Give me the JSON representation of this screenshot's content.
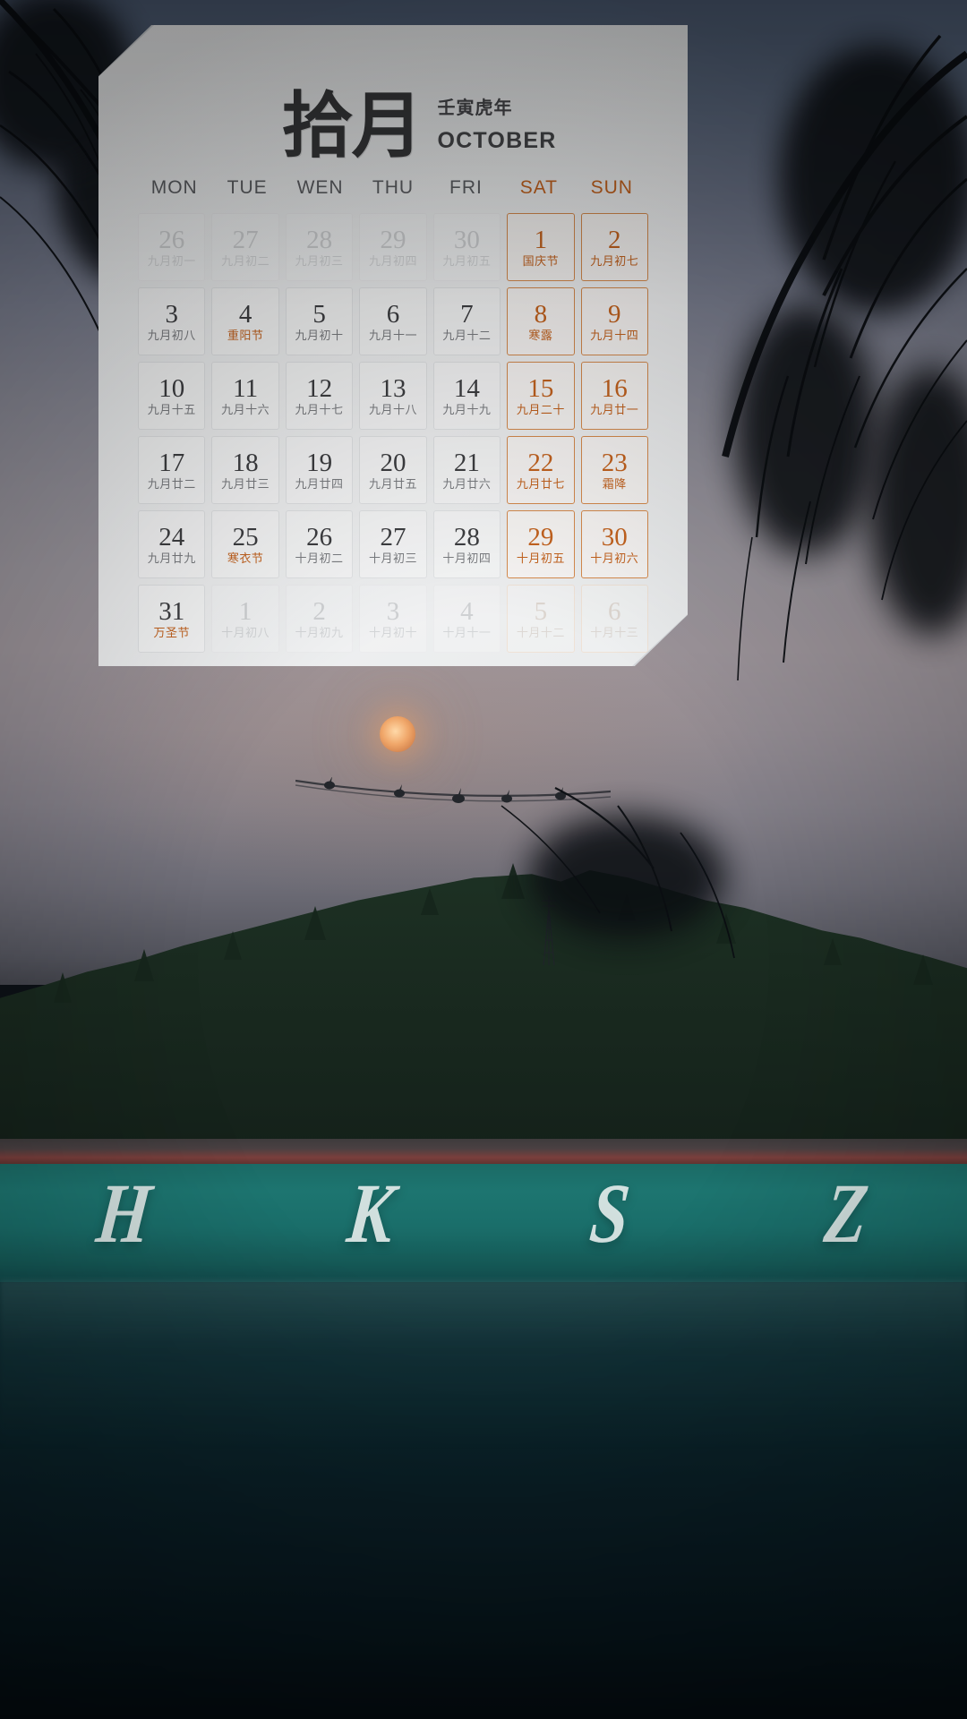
{
  "card": {
    "month_cn": "拾月",
    "year_cn": "壬寅虎年",
    "month_en": "OCTOBER"
  },
  "weekdays": [
    {
      "label": "MON",
      "weekend": false
    },
    {
      "label": "TUE",
      "weekend": false
    },
    {
      "label": "WEN",
      "weekend": false
    },
    {
      "label": "THU",
      "weekend": false
    },
    {
      "label": "FRI",
      "weekend": false
    },
    {
      "label": "SAT",
      "weekend": true
    },
    {
      "label": "SUN",
      "weekend": true
    }
  ],
  "days": [
    {
      "num": "26",
      "lunar": "九月初一",
      "muted": true,
      "weekend": false,
      "festival": false
    },
    {
      "num": "27",
      "lunar": "九月初二",
      "muted": true,
      "weekend": false,
      "festival": false
    },
    {
      "num": "28",
      "lunar": "九月初三",
      "muted": true,
      "weekend": false,
      "festival": false
    },
    {
      "num": "29",
      "lunar": "九月初四",
      "muted": true,
      "weekend": false,
      "festival": false
    },
    {
      "num": "30",
      "lunar": "九月初五",
      "muted": true,
      "weekend": false,
      "festival": false
    },
    {
      "num": "1",
      "lunar": "国庆节",
      "muted": false,
      "weekend": true,
      "festival": true
    },
    {
      "num": "2",
      "lunar": "九月初七",
      "muted": false,
      "weekend": true,
      "festival": false
    },
    {
      "num": "3",
      "lunar": "九月初八",
      "muted": false,
      "weekend": false,
      "festival": false
    },
    {
      "num": "4",
      "lunar": "重阳节",
      "muted": false,
      "weekend": false,
      "festival": true
    },
    {
      "num": "5",
      "lunar": "九月初十",
      "muted": false,
      "weekend": false,
      "festival": false
    },
    {
      "num": "6",
      "lunar": "九月十一",
      "muted": false,
      "weekend": false,
      "festival": false
    },
    {
      "num": "7",
      "lunar": "九月十二",
      "muted": false,
      "weekend": false,
      "festival": false
    },
    {
      "num": "8",
      "lunar": "寒露",
      "muted": false,
      "weekend": true,
      "festival": true
    },
    {
      "num": "9",
      "lunar": "九月十四",
      "muted": false,
      "weekend": true,
      "festival": false
    },
    {
      "num": "10",
      "lunar": "九月十五",
      "muted": false,
      "weekend": false,
      "festival": false
    },
    {
      "num": "11",
      "lunar": "九月十六",
      "muted": false,
      "weekend": false,
      "festival": false
    },
    {
      "num": "12",
      "lunar": "九月十七",
      "muted": false,
      "weekend": false,
      "festival": false
    },
    {
      "num": "13",
      "lunar": "九月十八",
      "muted": false,
      "weekend": false,
      "festival": false
    },
    {
      "num": "14",
      "lunar": "九月十九",
      "muted": false,
      "weekend": false,
      "festival": false
    },
    {
      "num": "15",
      "lunar": "九月二十",
      "muted": false,
      "weekend": true,
      "festival": false
    },
    {
      "num": "16",
      "lunar": "九月廿一",
      "muted": false,
      "weekend": true,
      "festival": false
    },
    {
      "num": "17",
      "lunar": "九月廿二",
      "muted": false,
      "weekend": false,
      "festival": false
    },
    {
      "num": "18",
      "lunar": "九月廿三",
      "muted": false,
      "weekend": false,
      "festival": false
    },
    {
      "num": "19",
      "lunar": "九月廿四",
      "muted": false,
      "weekend": false,
      "festival": false
    },
    {
      "num": "20",
      "lunar": "九月廿五",
      "muted": false,
      "weekend": false,
      "festival": false
    },
    {
      "num": "21",
      "lunar": "九月廿六",
      "muted": false,
      "weekend": false,
      "festival": false
    },
    {
      "num": "22",
      "lunar": "九月廿七",
      "muted": false,
      "weekend": true,
      "festival": false
    },
    {
      "num": "23",
      "lunar": "霜降",
      "muted": false,
      "weekend": true,
      "festival": true
    },
    {
      "num": "24",
      "lunar": "九月廿九",
      "muted": false,
      "weekend": false,
      "festival": false
    },
    {
      "num": "25",
      "lunar": "寒衣节",
      "muted": false,
      "weekend": false,
      "festival": true
    },
    {
      "num": "26",
      "lunar": "十月初二",
      "muted": false,
      "weekend": false,
      "festival": false
    },
    {
      "num": "27",
      "lunar": "十月初三",
      "muted": false,
      "weekend": false,
      "festival": false
    },
    {
      "num": "28",
      "lunar": "十月初四",
      "muted": false,
      "weekend": false,
      "festival": false
    },
    {
      "num": "29",
      "lunar": "十月初五",
      "muted": false,
      "weekend": true,
      "festival": false
    },
    {
      "num": "30",
      "lunar": "十月初六",
      "muted": false,
      "weekend": true,
      "festival": false
    },
    {
      "num": "31",
      "lunar": "万圣节",
      "muted": false,
      "weekend": false,
      "festival": true
    },
    {
      "num": "1",
      "lunar": "十月初八",
      "muted": true,
      "weekend": false,
      "festival": false
    },
    {
      "num": "2",
      "lunar": "十月初九",
      "muted": true,
      "weekend": false,
      "festival": false
    },
    {
      "num": "3",
      "lunar": "十月初十",
      "muted": true,
      "weekend": false,
      "festival": false
    },
    {
      "num": "4",
      "lunar": "十月十一",
      "muted": true,
      "weekend": false,
      "festival": false
    },
    {
      "num": "5",
      "lunar": "十月十二",
      "muted": true,
      "weekend": true,
      "festival": false
    },
    {
      "num": "6",
      "lunar": "十月十三",
      "muted": true,
      "weekend": true,
      "festival": false
    }
  ],
  "background": {
    "pool_letters": [
      "H",
      "K",
      "S",
      "Z"
    ],
    "colors": {
      "accent_orange": "#c4631f",
      "card_paper": "#f1f2f3",
      "sky_top": "#4d5c74",
      "water": "#1d7570",
      "moon": "#e8a063"
    }
  }
}
